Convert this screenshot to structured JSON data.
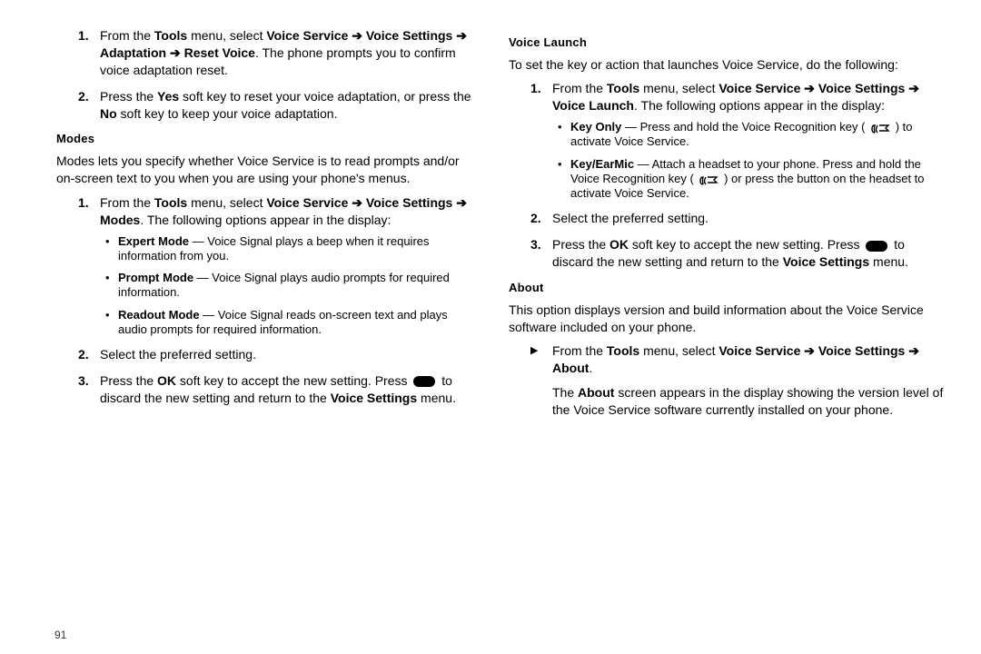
{
  "pageNumber": "91",
  "left": {
    "resetSteps": [
      {
        "pre": "From the ",
        "b1": "Tools",
        "mid1": " menu, select ",
        "b2": "Voice Service",
        "b3": "Voice Settings",
        "b4": "Adaptation",
        "b5": "Reset Voice",
        "tail": ". The phone prompts you to confirm voice adaptation reset."
      },
      {
        "pre": "Press the ",
        "b1": "Yes",
        "mid": " soft key to reset your voice adaptation, or press the ",
        "b2": "No",
        "tail": " soft key to keep your voice adaptation."
      }
    ],
    "modes": {
      "heading": "Modes",
      "intro": "Modes lets you specify whether Voice Service is to read prompts and/or on-screen text to you when you are using your phone's menus.",
      "steps": [
        {
          "pre": "From the ",
          "b1": "Tools",
          "mid1": " menu, select ",
          "b2": "Voice Service",
          "b3": "Voice Settings",
          "b4": "Modes",
          "tail": ". The following options appear in the display:"
        },
        {
          "t": "Select the preferred setting."
        },
        {
          "pre": "Press the ",
          "b1": "OK",
          "mid": " soft key to accept the new setting. Press ",
          "mid2": " to discard the new setting and return to the ",
          "b2": "Voice Settings",
          "tail": " menu."
        }
      ],
      "bullets": [
        {
          "b": "Expert Mode",
          "t": " — Voice Signal plays a beep when it requires information from you."
        },
        {
          "b": "Prompt Mode",
          "t": " — Voice Signal plays audio prompts for required information."
        },
        {
          "b": "Readout Mode",
          "t": " — Voice Signal reads on-screen text and plays audio prompts for required information."
        }
      ]
    }
  },
  "right": {
    "launch": {
      "heading": "Voice Launch",
      "intro": "To set the key or action that launches Voice Service, do the following:",
      "steps": [
        {
          "pre": "From the ",
          "b1": "Tools",
          "mid1": " menu, select ",
          "b2": "Voice Service",
          "b3": "Voice Settings",
          "b4": "Voice Launch",
          "tail": ". The following options appear in the display:"
        },
        {
          "t": "Select the preferred setting."
        },
        {
          "pre": "Press the ",
          "b1": "OK",
          "mid": " soft key to accept the new setting. Press ",
          "mid2": " to discard the new setting and return to the ",
          "b2": "Voice Settings",
          "tail": " menu."
        }
      ],
      "bullets": [
        {
          "b": "Key Only",
          "t1": " — Press and hold the Voice Recognition key ( ",
          "t2": " ) to activate Voice Service."
        },
        {
          "b": "Key/EarMic",
          "t1": " — Attach a headset to your phone. Press and hold the Voice Recognition key ( ",
          "t2": " ) or press the button on the headset to activate Voice Service."
        }
      ]
    },
    "about": {
      "heading": "About",
      "intro": "This option displays version and build information about the Voice Service software included on your phone.",
      "step": {
        "pre": "From the ",
        "b1": "Tools",
        "mid1": " menu, select ",
        "b2": "Voice Service",
        "b3": "Voice Settings",
        "b4": "About",
        "dot": "."
      },
      "result": {
        "pre": "The ",
        "b": "About",
        "tail": " screen appears in the display showing the version level of the Voice Service software currently installed on your phone."
      }
    }
  }
}
